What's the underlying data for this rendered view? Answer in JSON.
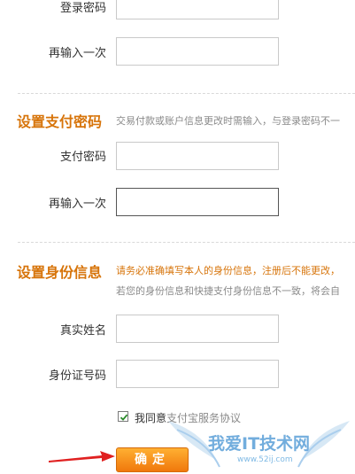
{
  "login_section": {
    "login_password_label": "登录密码",
    "confirm_login_password_label": "再输入一次"
  },
  "payment_section": {
    "title": "设置支付密码",
    "hint": "交易付款或账户信息更改时需输入，与登录密码不一",
    "payment_password_label": "支付密码",
    "confirm_payment_password_label": "再输入一次"
  },
  "identity_section": {
    "title": "设置身份信息",
    "hint_warning": "请务必准确填写本人的身份信息，注册后不能更改，",
    "hint_note": "若您的身份信息和快捷支付身份信息不一致，将会自",
    "real_name_label": "真实姓名",
    "id_number_label": "身份证号码"
  },
  "agreement": {
    "prefix": "我同意",
    "link_text": "支付宝服务协议",
    "checked": true
  },
  "confirm_button_label": "确定",
  "watermark": {
    "text": "我爱IT技术网",
    "url": "www.52ij.com"
  },
  "colors": {
    "section_title": "#d7740a",
    "button_start": "#ffb032",
    "button_end": "#f0780c",
    "arrow": "#e02020",
    "watermark": "#5a9fd8"
  }
}
